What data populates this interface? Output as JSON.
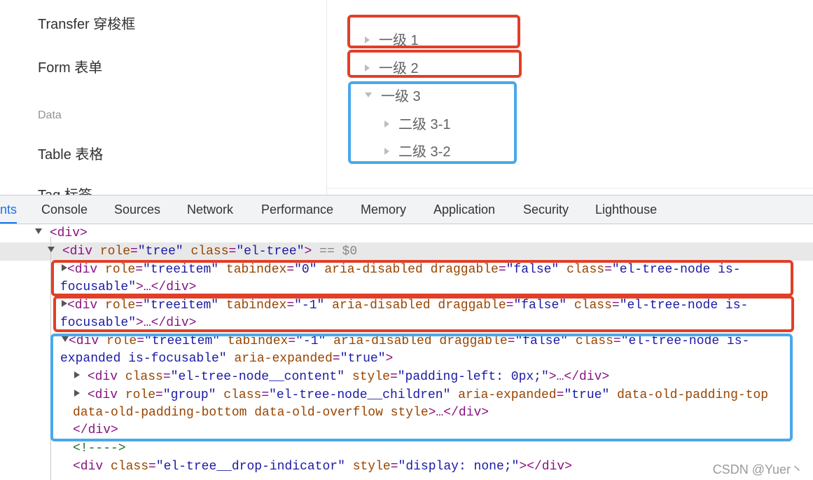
{
  "sidebar": {
    "items": [
      {
        "label": "Transfer 穿梭框"
      },
      {
        "label": "Form 表单"
      },
      {
        "label": "Table 表格"
      },
      {
        "label": "Tag 标签"
      }
    ],
    "group_data": "Data"
  },
  "tree": {
    "node1": "一级 1",
    "node2": "一级 2",
    "node3": "一级 3",
    "node3_1": "二级 3-1",
    "node3_2": "二级 3-2"
  },
  "devtools": {
    "tabs": [
      "nts",
      "Console",
      "Sources",
      "Network",
      "Performance",
      "Memory",
      "Application",
      "Security",
      "Lighthouse"
    ],
    "active_tab": "Elements"
  },
  "dom": {
    "l1_tag": "<div>",
    "l2_open": "<div ",
    "l2_a1": "role",
    "l2_v1": "\"tree\"",
    "l2_a2": "class",
    "l2_v2": "\"el-tree\"",
    "l2_close": ">",
    "l2_suffix": " == $0",
    "n1_tabindex": "\"0\"",
    "n2_tabindex": "\"-1\"",
    "n3_tabindex": "\"-1\"",
    "attr_role": "role",
    "val_treeitem": "\"treeitem\"",
    "attr_tabindex": "tabindex",
    "attr_ariadis": "aria-disabled",
    "attr_draggable": "draggable",
    "val_false": "\"false\"",
    "attr_class": "class",
    "val_node_a": "\"el-tree-node is-",
    "val_node_b": "focusable\"",
    "val_exp_a": "\"el-tree-node is-",
    "val_exp_b": "expanded is-focusable\"",
    "attr_ariaexp": "aria-expanded",
    "val_true": "\"true\"",
    "collapsed_end": ">…</div>",
    "content_class": "\"el-tree-node__content\"",
    "attr_style": "style",
    "content_style": "\"padding-left: 0px;\"",
    "val_group": "\"group\"",
    "children_class": "\"el-tree-node__children\"",
    "old_attrs_a": "data-old-padding-top",
    "old_attrs_b": "data-old-padding-bottom data-old-overflow style",
    "close_div": "</div>",
    "comment": "<!---->",
    "drop_class": "\"el-tree__drop-indicator\"",
    "drop_style": "\"display: none;\""
  },
  "watermark": "CSDN @Yuer丶",
  "colors": {
    "red_box": "#e13f27",
    "blue_box": "#4aa8ea",
    "tab_active": "#1a73e8"
  }
}
